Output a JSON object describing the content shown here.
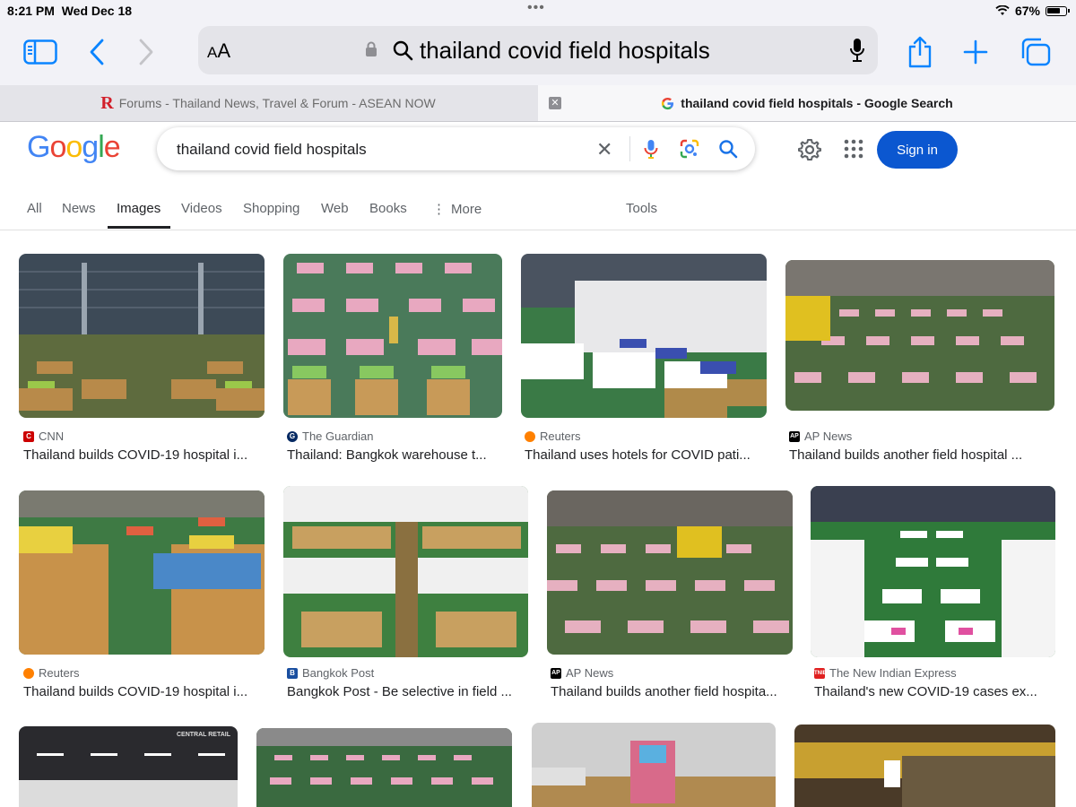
{
  "status": {
    "time": "8:21 PM",
    "date": "Wed Dec 18",
    "battery": "67%"
  },
  "toolbar": {
    "text_size_label": "AA",
    "url": "thailand covid field hospitals"
  },
  "tabs": [
    {
      "label": "Forums - Thailand News, Travel & Forum - ASEAN NOW",
      "logo": "R"
    },
    {
      "label": "thailand covid field hospitals - Google Search",
      "logo": "G"
    }
  ],
  "google": {
    "query": "thailand covid field hospitals",
    "sign_in": "Sign in",
    "nav": [
      "All",
      "News",
      "Images",
      "Videos",
      "Shopping",
      "Web",
      "Books",
      "More",
      "Tools"
    ],
    "active_nav": "Images"
  },
  "results": [
    {
      "source": "CNN",
      "title": "Thailand builds COVID-19 hospital i..."
    },
    {
      "source": "The Guardian",
      "title": "Thailand: Bangkok warehouse t..."
    },
    {
      "source": "Reuters",
      "title": "Thailand uses hotels for COVID pati..."
    },
    {
      "source": "AP News",
      "title": "Thailand builds another field hospital ..."
    },
    {
      "source": "Reuters",
      "title": "Thailand builds COVID-19 hospital i..."
    },
    {
      "source": "Bangkok Post",
      "title": "Bangkok Post - Be selective in field ..."
    },
    {
      "source": "AP News",
      "title": "Thailand builds another field hospita..."
    },
    {
      "source": "The New Indian Express",
      "title": "Thailand's new COVID-19 cases ex..."
    }
  ],
  "partial_thumb_text": "CENTRAL RETAIL",
  "colors": {
    "accent": "#0b57d0",
    "cnn": "#cc0000",
    "reuters": "#ff8000",
    "guardian": "#052962",
    "ap": "#000000",
    "bkkpost": "#1a4fa0",
    "nie": "#e02020"
  }
}
